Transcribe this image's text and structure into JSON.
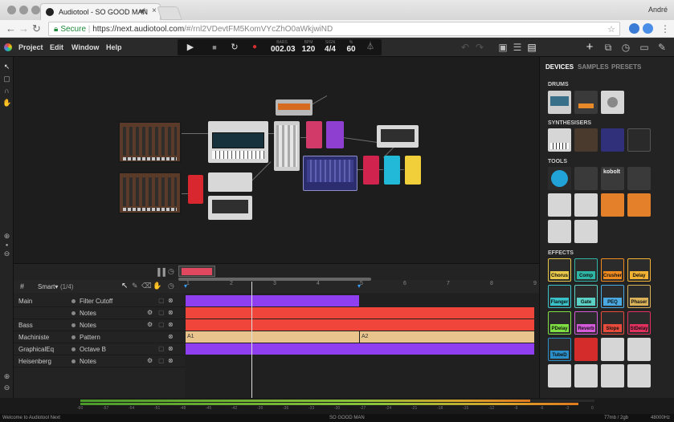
{
  "browser": {
    "tab_title": "Audiotool - SO GOOD MAN",
    "user": "André",
    "secure_label": "Secure",
    "url_host": "https://next.audiotool.com",
    "url_path": "/#/rnl2VDevtFM5KomVYcZhO0aWkjwiND"
  },
  "app_menu": [
    "Project",
    "Edit",
    "Window",
    "Help"
  ],
  "transport": {
    "bars": {
      "label": "BARS",
      "value": "002.03"
    },
    "bpm": {
      "label": "BPM",
      "value": "120"
    },
    "sign": {
      "label": "SIGN",
      "value": "4/4"
    },
    "sw": {
      "label": "%",
      "value": "60"
    }
  },
  "panel": {
    "tabs": [
      "DEVICES",
      "SAMPLES",
      "PRESETS"
    ],
    "sections": {
      "drums": "DRUMS",
      "synths": "SYNTHESISERS",
      "tools": "TOOLS",
      "effects": "EFFECTS"
    },
    "tool_label": "kobolt",
    "effects": [
      {
        "name": "Chorus",
        "color": "#e8c84a",
        "tile": "#2b2b2b"
      },
      {
        "name": "Comp",
        "color": "#2fb5a5",
        "tile": "#2b2b2b"
      },
      {
        "name": "Crusher",
        "color": "#ef8a1f",
        "tile": "#2b2b2b"
      },
      {
        "name": "Delay",
        "color": "#f2b233",
        "tile": "#2b2b2b"
      },
      {
        "name": "Flanger",
        "color": "#39c3c9",
        "tile": "#2b2b2b"
      },
      {
        "name": "Gate",
        "color": "#5ad1c4",
        "tile": "#2b2b2b"
      },
      {
        "name": "PEQ",
        "color": "#49a9e0",
        "tile": "#2b2b2b"
      },
      {
        "name": "Phaser",
        "color": "#d9b25a",
        "tile": "#2b2b2b"
      },
      {
        "name": "PDelay",
        "color": "#7ee043",
        "tile": "#2b2b2b"
      },
      {
        "name": "Reverb",
        "color": "#d35ad8",
        "tile": "#2b2b2b"
      },
      {
        "name": "Slope",
        "color": "#e84b3c",
        "tile": "#2b2b2b"
      },
      {
        "name": "StDelay",
        "color": "#e0315f",
        "tile": "#2b2b2b"
      },
      {
        "name": "TubeD",
        "color": "#2a8ec9",
        "tile": "#2b2b2b"
      }
    ]
  },
  "timeline": {
    "mode": "Smart",
    "page": "(1/4)",
    "ruler": [
      "1",
      "2",
      "3",
      "4",
      "5",
      "6",
      "7",
      "8",
      "9"
    ],
    "tracks": [
      {
        "name": "Main",
        "param": "Filter Cutoff"
      },
      {
        "name": "",
        "param": "Notes"
      },
      {
        "name": "Bass",
        "param": "Notes"
      },
      {
        "name": "Machiniste",
        "param": "Pattern"
      },
      {
        "name": "GraphicalEq",
        "param": "Octave B"
      },
      {
        "name": "Heisenberg",
        "param": "Notes"
      }
    ],
    "clip_labels": [
      "A1",
      "A2"
    ]
  },
  "meter_ticks": [
    "-60",
    "-57",
    "-54",
    "-51",
    "-48",
    "-45",
    "-42",
    "-39",
    "-36",
    "-33",
    "-30",
    "-27",
    "-24",
    "-21",
    "-18",
    "-15",
    "-12",
    "-9",
    "-6",
    "-3",
    "0"
  ],
  "status": {
    "left": "Welcome to Audiotool Next",
    "center": "SO GOOD MAN",
    "right_mem": "77mb / 2gb",
    "right_rate": "48000Hz"
  },
  "colors": {
    "purple": "#8f3ff0",
    "red": "#f0453a",
    "tan": "#e9c48d",
    "accent_bg": "#1d1d1d"
  }
}
